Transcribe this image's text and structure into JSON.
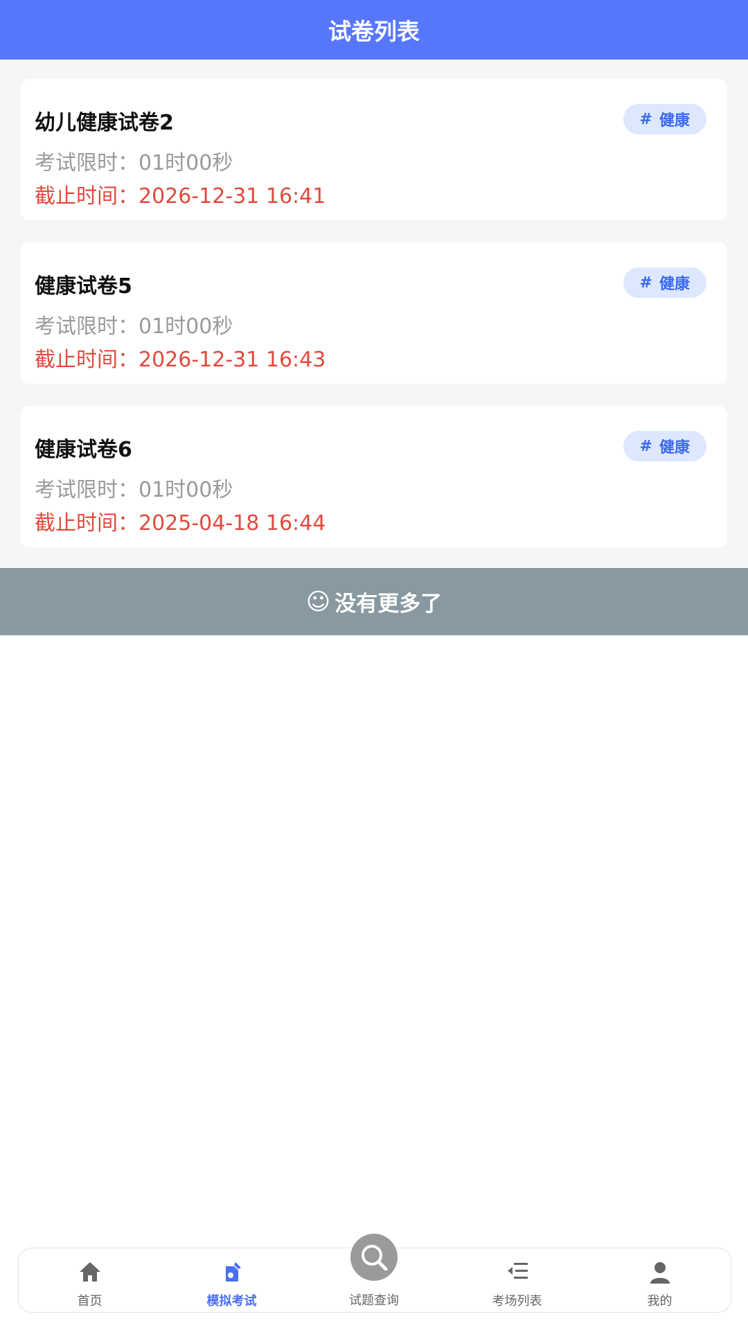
{
  "header": {
    "title": "试卷列表"
  },
  "papers": [
    {
      "title": "幼儿健康试卷2",
      "tag": "健康",
      "limit_label": "考试限时：",
      "limit_value": "01时00秒",
      "deadline_label": "截止时间：",
      "deadline_value": "2026-12-31 16:41"
    },
    {
      "title": "健康试卷5",
      "tag": "健康",
      "limit_label": "考试限时：",
      "limit_value": "01时00秒",
      "deadline_label": "截止时间：",
      "deadline_value": "2026-12-31 16:43"
    },
    {
      "title": "健康试卷6",
      "tag": "健康",
      "limit_label": "考试限时：",
      "limit_value": "01时00秒",
      "deadline_label": "截止时间：",
      "deadline_value": "2025-04-18 16:44"
    }
  ],
  "no_more": {
    "icon": "smile-icon",
    "text": "没有更多了"
  },
  "tabbar": {
    "items": [
      {
        "label": "首页",
        "icon": "home-icon"
      },
      {
        "label": "模拟考试",
        "icon": "exam-edit-icon",
        "active": true
      },
      {
        "label": "试题查询",
        "icon": "search-icon"
      },
      {
        "label": "考场列表",
        "icon": "list-icon"
      },
      {
        "label": "我的",
        "icon": "user-icon"
      }
    ]
  },
  "colors": {
    "header_bg": "#5677fc",
    "deadline_text": "#e04a3c",
    "tag_bg": "#dde8ff",
    "tag_text": "#3d6af0",
    "no_more_bg": "#8899a2",
    "tab_active": "#4a6ff2"
  }
}
